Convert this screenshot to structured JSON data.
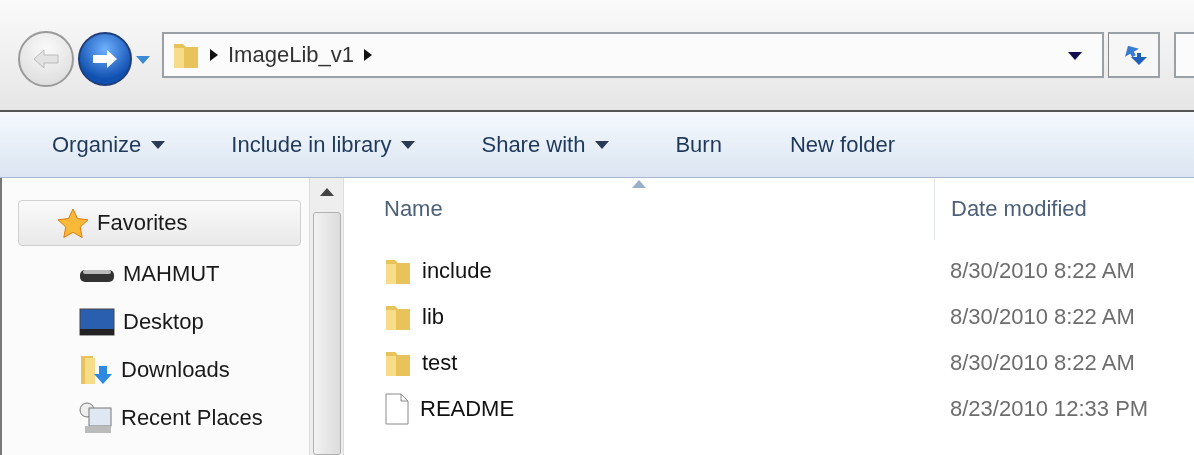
{
  "address_bar": {
    "path": [
      "ImageLib_v1"
    ]
  },
  "toolbar": [
    {
      "label": "Organize",
      "dropdown": true
    },
    {
      "label": "Include in library",
      "dropdown": true
    },
    {
      "label": "Share with",
      "dropdown": true
    },
    {
      "label": "Burn",
      "dropdown": false
    },
    {
      "label": "New folder",
      "dropdown": false
    }
  ],
  "sidebar": {
    "items": [
      {
        "label": "Favorites",
        "kind": "favorites",
        "selected": true
      },
      {
        "label": "MAHMUT",
        "kind": "drive",
        "selected": false
      },
      {
        "label": "Desktop",
        "kind": "desktop",
        "selected": false
      },
      {
        "label": "Downloads",
        "kind": "downloads",
        "selected": false
      },
      {
        "label": "Recent Places",
        "kind": "recent",
        "selected": false
      }
    ]
  },
  "table": {
    "columns": [
      {
        "label": "Name",
        "sorted": true
      },
      {
        "label": "Date modified",
        "sorted": false
      }
    ],
    "rows": [
      {
        "name": "include",
        "kind": "folder",
        "date": "8/30/2010 8:22 AM"
      },
      {
        "name": "lib",
        "kind": "folder",
        "date": "8/30/2010 8:22 AM"
      },
      {
        "name": "test",
        "kind": "folder",
        "date": "8/30/2010 8:22 AM"
      },
      {
        "name": "README",
        "kind": "file",
        "date": "8/23/2010 12:33 PM"
      }
    ]
  }
}
